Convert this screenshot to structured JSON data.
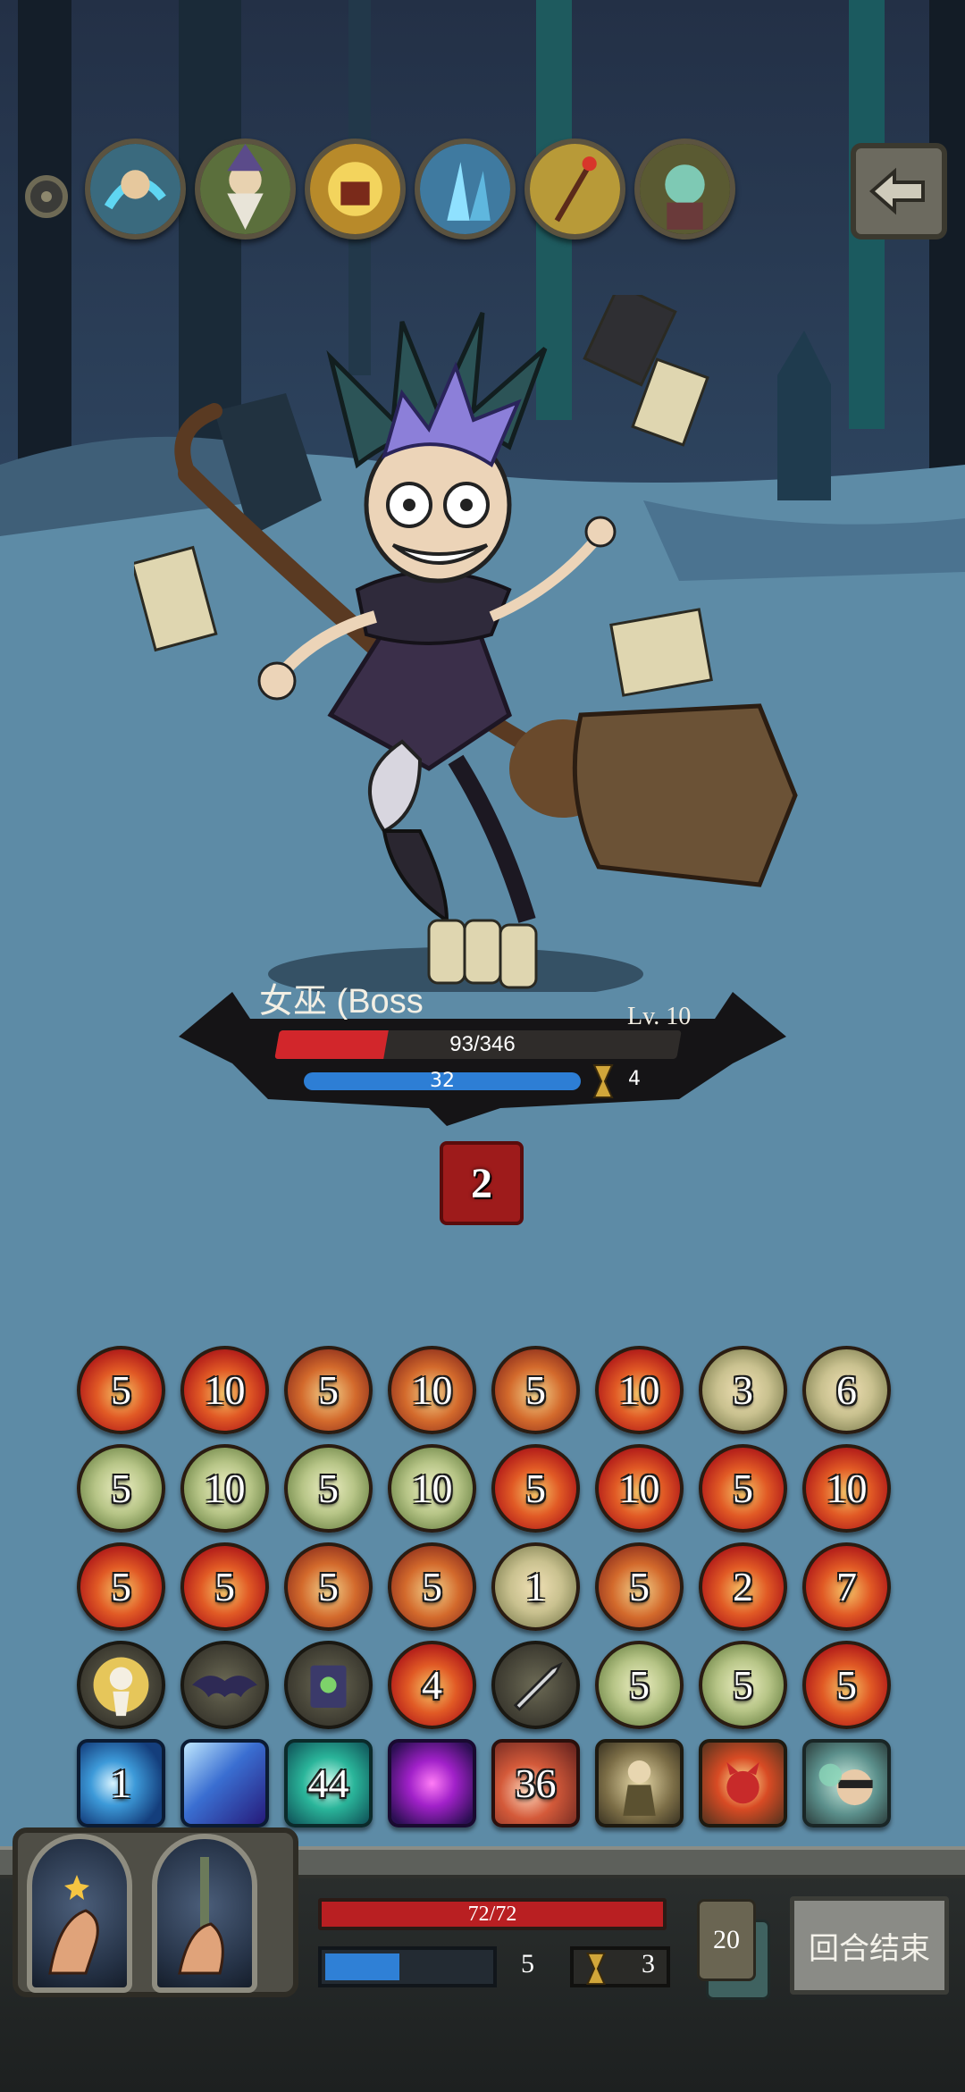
{
  "header": {
    "relic_icons": [
      "water-hand-icon",
      "old-wizard-icon",
      "flaming-book-icon",
      "crystal-shard-icon",
      "wand-icon",
      "zombie-icon"
    ],
    "back_icon": "back-arrow-icon"
  },
  "boss": {
    "name": "女巫 (Boss",
    "level": "Lv. 10",
    "hp_text": "93/346",
    "hp_fraction": 0.27,
    "mp_text": "32",
    "mp_fraction": 1.0,
    "turns": "4",
    "intent_value": "2",
    "hp_color": "#d2262b",
    "mp_color": "#2d7ed5"
  },
  "cards": {
    "row1": [
      {
        "type": "fire",
        "value": "5"
      },
      {
        "type": "fire",
        "value": "10"
      },
      {
        "type": "burst",
        "value": "5"
      },
      {
        "type": "burst",
        "value": "10"
      },
      {
        "type": "burst",
        "value": "5"
      },
      {
        "type": "fire",
        "value": "10"
      },
      {
        "type": "ghost",
        "value": "3"
      },
      {
        "type": "ghost",
        "value": "6"
      }
    ],
    "row2": [
      {
        "type": "leaf",
        "value": "5"
      },
      {
        "type": "leaf",
        "value": "10"
      },
      {
        "type": "leaf",
        "value": "5"
      },
      {
        "type": "leaf",
        "value": "10"
      },
      {
        "type": "fire",
        "value": "5"
      },
      {
        "type": "fire",
        "value": "10"
      },
      {
        "type": "fire",
        "value": "5"
      },
      {
        "type": "fire",
        "value": "10"
      }
    ],
    "row3": [
      {
        "type": "fire",
        "value": "5"
      },
      {
        "type": "fire",
        "value": "5"
      },
      {
        "type": "burst",
        "value": "5"
      },
      {
        "type": "burst",
        "value": "5"
      },
      {
        "type": "ghost",
        "value": "1"
      },
      {
        "type": "burst",
        "value": "5"
      },
      {
        "type": "fire",
        "value": "2"
      },
      {
        "type": "fire",
        "value": "7"
      }
    ],
    "row4": [
      {
        "type": "slot",
        "icon": "lightning-mage-icon",
        "value": ""
      },
      {
        "type": "slot",
        "icon": "bat-icon",
        "value": ""
      },
      {
        "type": "slot",
        "icon": "spellbook-icon",
        "value": ""
      },
      {
        "type": "fire",
        "value": "4"
      },
      {
        "type": "slot",
        "icon": "sword-icon",
        "value": ""
      },
      {
        "type": "leaf",
        "value": "5"
      },
      {
        "type": "leaf",
        "value": "5"
      },
      {
        "type": "fire",
        "value": "5"
      }
    ],
    "row5": [
      {
        "type": "skill-ice",
        "value": "1"
      },
      {
        "type": "skill-storm",
        "value": ""
      },
      {
        "type": "skill-teal",
        "value": "44"
      },
      {
        "type": "skill-violet",
        "value": ""
      },
      {
        "type": "skill-rust",
        "value": "36"
      },
      {
        "type": "skill-monk",
        "icon": "monk-icon",
        "value": ""
      },
      {
        "type": "skill-demon",
        "icon": "demon-icon",
        "value": ""
      },
      {
        "type": "skill-smoke",
        "icon": "thief-icon",
        "value": ""
      }
    ]
  },
  "player": {
    "hp_text": "72/72",
    "mp_value": "5",
    "mp_fraction": 0.45,
    "turns": "3",
    "deck_count": "20",
    "end_turn_label": "回合结束"
  }
}
